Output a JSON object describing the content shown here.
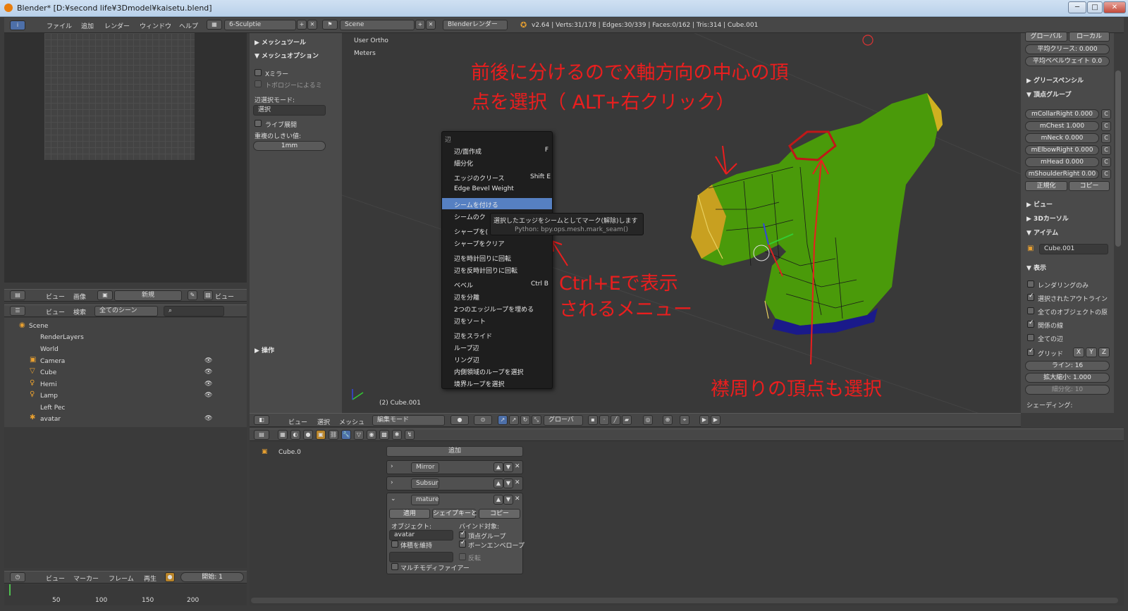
{
  "window": {
    "title": "Blender* [D:¥second life¥3Dmodel¥kaisetu.blend]",
    "btn_min": "─",
    "btn_max": "□",
    "btn_close": "✕"
  },
  "menubar": {
    "items": [
      "ファイル",
      "追加",
      "レンダー",
      "ウィンドウ",
      "ヘルプ"
    ],
    "layout": "6-Sculptie",
    "scene": "Scene",
    "engine": "Blenderレンダー",
    "stats": "v2.64 | Verts:31/178 | Edges:30/339 | Faces:0/162 | Tris:314 | Cube.001"
  },
  "image_editor": {
    "header": [
      "ビュー",
      "画像"
    ],
    "new_btn": "新規",
    "view_label": "ビュー"
  },
  "outliner": {
    "header": [
      "ビュー",
      "検索"
    ],
    "scene_select": "全てのシーン",
    "items": [
      "Scene",
      "RenderLayers",
      "World",
      "Camera",
      "Cube",
      "Hemi",
      "Lamp",
      "Left Pec",
      "avatar"
    ]
  },
  "timeline": {
    "header": [
      "ビュー",
      "マーカー",
      "フレーム",
      "再生"
    ],
    "start": "開始: 1",
    "ticks": [
      "50",
      "100",
      "150",
      "200"
    ]
  },
  "toolshelf": {
    "mesh_tools": "▶ メッシュツール",
    "mesh_options": "▼ メッシュオプション",
    "x_mirror": "Xミラー",
    "topology": "トポロジーによるミ",
    "edge_select_mode": "辺選択モード:",
    "select_value": "選択",
    "live_unwrap": "ライブ展開",
    "double_threshold": "重複のしきい値:",
    "threshold_value": "1mm",
    "operator": "▶ 操作"
  },
  "viewport": {
    "view_name": "User Ortho",
    "units": "Meters",
    "object": "(2) Cube.001",
    "header": {
      "view": "ビュー",
      "select": "選択",
      "mesh": "メッシュ",
      "mode": "編集モード",
      "orientation": "グローバ"
    }
  },
  "annotations": {
    "a1_l1": "前後に分けるのでX軸方向の中心の頂",
    "a1_l2": "点を選択（ ALT+右クリック）",
    "a2_l1": "Ctrl+Eで表示",
    "a2_l2": "されるメニュー",
    "a3": "襟周りの頂点も選択"
  },
  "context_menu": {
    "title": "辺",
    "items": [
      {
        "label": "辺/面作成",
        "shortcut": "F"
      },
      {
        "label": "細分化",
        "shortcut": ""
      },
      {
        "label": "エッジのクリース",
        "shortcut": "Shift E"
      },
      {
        "label": "Edge Bevel Weight",
        "shortcut": ""
      },
      {
        "label": "シームを付ける",
        "shortcut": ""
      },
      {
        "label": "シームのク",
        "shortcut": ""
      },
      {
        "label": "シャープを(",
        "shortcut": ""
      },
      {
        "label": "シャープをクリア",
        "shortcut": ""
      },
      {
        "label": "辺を時計回りに回転",
        "shortcut": ""
      },
      {
        "label": "辺を反時計回りに回転",
        "shortcut": ""
      },
      {
        "label": "ベベル",
        "shortcut": "Ctrl B"
      },
      {
        "label": "辺を分離",
        "shortcut": ""
      },
      {
        "label": "2つのエッジループを埋める",
        "shortcut": ""
      },
      {
        "label": "辺をソート",
        "shortcut": ""
      },
      {
        "label": "辺をスライド",
        "shortcut": ""
      },
      {
        "label": "ループ辺",
        "shortcut": ""
      },
      {
        "label": "リング辺",
        "shortcut": ""
      },
      {
        "label": "内側領域のループを選択",
        "shortcut": ""
      },
      {
        "label": "境界ループを選択",
        "shortcut": ""
      }
    ],
    "tooltip": "選択したエッジをシームとしてマーク(解除)します",
    "tooltip_python": "Python: bpy.ops.mesh.mark_seam()"
  },
  "properties": {
    "global_btn": "グローバル",
    "local_btn": "ローカル",
    "avg_crease": "平均クリース: 0.000",
    "avg_bevel": "平均ベベルウェイト 0.0",
    "grease": "▶ グリースペンシル",
    "vgroups": "▼ 頂点グループ",
    "groups": [
      "mCollarRight 0.000",
      "mChest 1.000",
      "mNeck 0.000",
      "mElbowRight 0.000",
      "mHead 0.000",
      "mShoulderRight 0.00"
    ],
    "normalize": "正規化",
    "copy": "コピー",
    "view": "▶ ビュー",
    "cursor": "▶ 3Dカーソル",
    "item": "▼ アイテム",
    "item_name": "Cube.001",
    "display": "▼ 表示",
    "disp": [
      "レンダリングのみ",
      "選択されたアウトライン",
      "全てのオブジェクトの原",
      "関係の線",
      "全ての辺"
    ],
    "grid": "グリッド",
    "x": "X",
    "y": "Y",
    "z": "Z",
    "lines": "ライン: 16",
    "scale": "拡大縮小: 1.000",
    "subdiv": "細分化: 10",
    "shading": "シェーディング:"
  },
  "modifiers": {
    "object": "Cube.0",
    "add": "追加",
    "names": [
      "Mirror",
      "Subsurf",
      "mature"
    ],
    "apply": "適用",
    "shapekey": "シェイプキーと",
    "copy": "コピー",
    "object_label": "オブジェクト:",
    "object_value": "avatar",
    "bind_label": "バインド対象:",
    "keep_volume": "体積を維持",
    "vgroups": "頂点グループ",
    "envelopes": "ボーンエンベロープ",
    "invert": "反転",
    "multi": "マルチモディファイアー"
  },
  "colors": {
    "annotation": "#ea1e1e",
    "mesh_green": "#4a9a0a",
    "highlight": "#5680c2"
  }
}
